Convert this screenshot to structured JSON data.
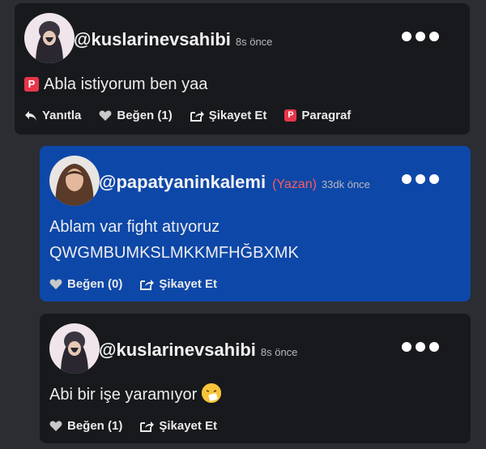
{
  "comments": [
    {
      "username": "@kuslarinevsahibi",
      "time": "8s önce",
      "text": "Abla istiyorum ben yaa",
      "text_icon": "paragraph-icon",
      "actions": {
        "reply": "Yanıtla",
        "like": "Beğen (1)",
        "report": "Şikayet Et",
        "paragraph": "Paragraf"
      }
    },
    {
      "username": "@papatyaninkalemi",
      "author_badge": "(Yazan)",
      "time": "33dk önce",
      "text_line1": "Ablam var fight atıyoruz",
      "text_line2": "QWGMBUMKSLMKKMFHĞBXMK",
      "actions": {
        "like": "Beğen (0)",
        "report": "Şikayet Et"
      }
    },
    {
      "username": "@kuslarinevsahibi",
      "time": "8s önce",
      "text": "Abi bir işe yaramıyor",
      "emoji": "sneezing-face-emoji",
      "actions": {
        "like": "Beğen (1)",
        "report": "Şikayet Et"
      }
    }
  ],
  "colors": {
    "page_bg": "#2b2d32",
    "card_bg": "#18191c",
    "author_card_bg": "#0d47a8",
    "author_badge": "#ff5c5c",
    "paragraph_badge": "#e8354a"
  }
}
